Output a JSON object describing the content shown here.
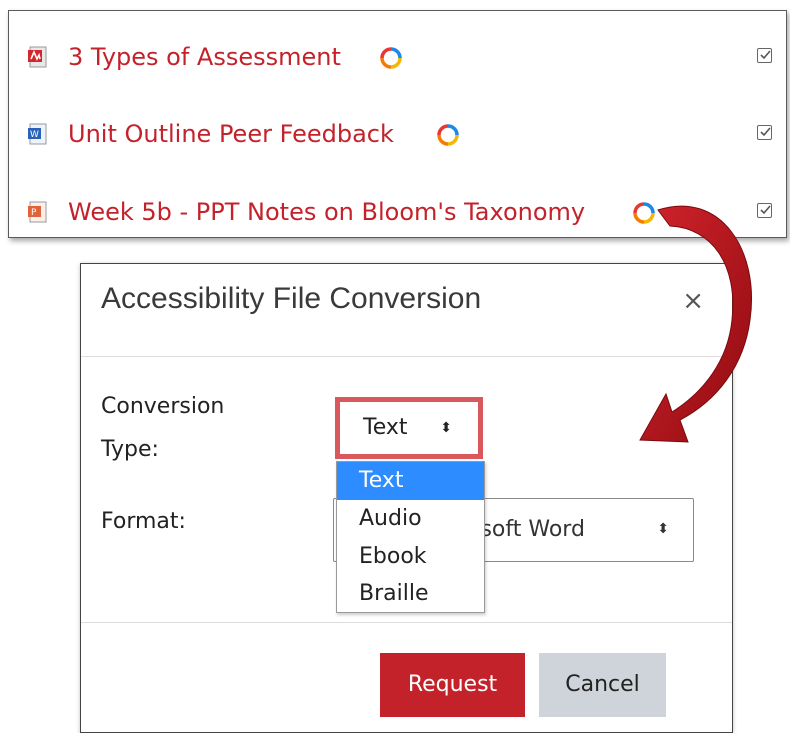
{
  "files": [
    {
      "name": "3 Types of Assessment",
      "icon": "pdf-file-icon",
      "sync_icon": "sync-icon",
      "checked": true
    },
    {
      "name": "Unit Outline Peer Feedback",
      "icon": "word-file-icon",
      "sync_icon": "sync-icon",
      "checked": true
    },
    {
      "name": "Week 5b - PPT Notes on Bloom's Taxonomy",
      "icon": "powerpoint-file-icon",
      "sync_icon": "sync-icon",
      "checked": true
    }
  ],
  "modal": {
    "title": "Accessibility File Conversion",
    "close_label": "×",
    "conversion_type": {
      "label_line1": "Conversion",
      "label_line2": "Type:",
      "selected": "Text",
      "options": [
        "Text",
        "Audio",
        "Ebook",
        "Braille"
      ]
    },
    "format": {
      "label": "Format:",
      "visible_value": "osoft Word"
    },
    "buttons": {
      "request": "Request",
      "cancel": "Cancel"
    }
  },
  "colors": {
    "link_red": "#c4222b",
    "highlight_border": "#d9585c",
    "dropdown_selected": "#2d8cff",
    "cancel_gray": "#ced4da",
    "arrow_red": "#c0141c"
  }
}
